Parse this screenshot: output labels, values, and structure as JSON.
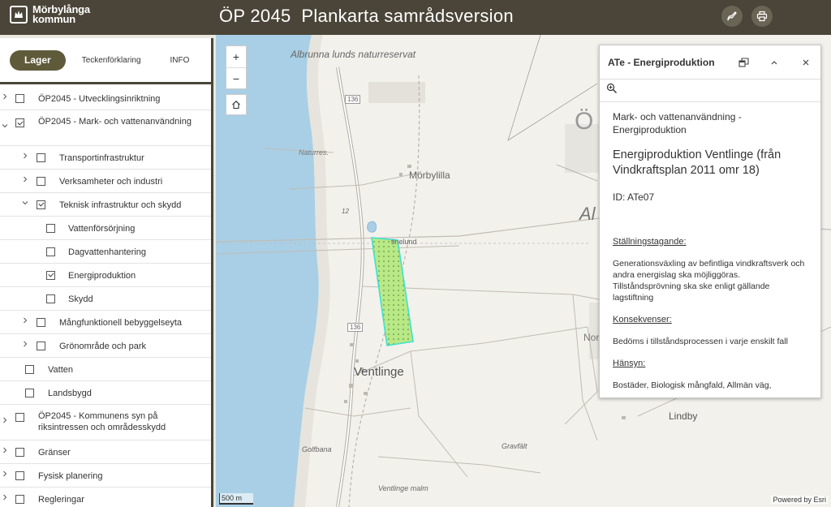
{
  "header": {
    "logo_line1": "Mörbylånga",
    "logo_line2": "kommun",
    "title": "ÖP 2045  Plankarta samrådsversion"
  },
  "tabs": [
    {
      "label": "Lager",
      "active": true
    },
    {
      "label": "Teckenförklaring",
      "active": false
    },
    {
      "label": "INFO",
      "active": false
    }
  ],
  "layers": [
    {
      "label": "ÖP2045 - Utvecklingsinriktning",
      "level": 0,
      "checked": false,
      "chevron": "right"
    },
    {
      "label": "ÖP2045 - Mark- och vattenanvändning",
      "level": 0,
      "checked": true,
      "chevron": "down"
    },
    {
      "label": "Transportinfrastruktur",
      "level": 1,
      "checked": false,
      "chevron": "right"
    },
    {
      "label": "Verksamheter och industri",
      "level": 1,
      "checked": false,
      "chevron": "right"
    },
    {
      "label": "Teknisk infrastruktur och skydd",
      "level": 1,
      "checked": true,
      "chevron": "down"
    },
    {
      "label": "Vattenförsörjning",
      "level": 2,
      "checked": false,
      "chevron": ""
    },
    {
      "label": "Dagvattenhantering",
      "level": 2,
      "checked": false,
      "chevron": ""
    },
    {
      "label": "Energiproduktion",
      "level": 2,
      "checked": true,
      "chevron": ""
    },
    {
      "label": "Skydd",
      "level": 2,
      "checked": false,
      "chevron": ""
    },
    {
      "label": "Mångfunktionell bebyggelseyta",
      "level": 1,
      "checked": false,
      "chevron": "right"
    },
    {
      "label": "Grönområde och park",
      "level": 1,
      "checked": false,
      "chevron": "right"
    },
    {
      "label": "Vatten",
      "level": 1,
      "checked": false,
      "chevron": "",
      "noindent_chev": true
    },
    {
      "label": "Landsbygd",
      "level": 1,
      "checked": false,
      "chevron": "",
      "noindent_chev": true
    },
    {
      "label": "ÖP2045 - Kommunens syn på riksintressen och områdesskydd",
      "level": 0,
      "checked": false,
      "chevron": "right"
    },
    {
      "label": "Gränser",
      "level": 0,
      "checked": false,
      "chevron": "right"
    },
    {
      "label": "Fysisk planering",
      "level": 0,
      "checked": false,
      "chevron": "right"
    },
    {
      "label": "Regleringar",
      "level": 0,
      "checked": false,
      "chevron": "right"
    }
  ],
  "map": {
    "labels": {
      "reserve": "Albrunna lunds naturreservat",
      "naturres": "Naturres.",
      "morbylilla": "Mörbylilla",
      "ventlinge": "Ventlinge",
      "ventlinge_malm": "Ventlinge malm",
      "golfbana": "Golfbana",
      "gravfalt": "Gravfält",
      "lindby": "Lindby",
      "stenlund": "tinelund",
      "nor": "Nor",
      "al": "Al",
      "o": "Ö",
      "road1": "136",
      "road2": "136",
      "h12": "12"
    },
    "scalebar": "500 m",
    "attribution": "Powered by Esri",
    "zoom_in": "+",
    "zoom_out": "−"
  },
  "popup": {
    "title": "ATe - Energiproduktion",
    "subtitle": "Mark- och vattenanvändning - Energiproduktion",
    "name": "Energiproduktion Ventlinge (från Vindkraftsplan 2011 omr 18)",
    "id": "ID: ATe07",
    "h1": "Ställningstagande:",
    "t1": "Generationsväxling av befintliga vindkraftsverk och andra energislag ska möjliggöras. Tillståndsprövning ska ske enligt gällande lagstiftning",
    "h2": "Konsekvenser:",
    "t2": "Bedöms i tillståndsprocessen i varje enskilt fall",
    "h3": "Hänsyn:",
    "t3": "Bostäder, Biologisk mångfald, Allmän väg,"
  },
  "colors": {
    "header": "#4a4538",
    "accent": "#5f5a3a",
    "water": "#a9cfe6",
    "polygon": "#b8e986",
    "polygon_outline": "#3fe0d0"
  }
}
